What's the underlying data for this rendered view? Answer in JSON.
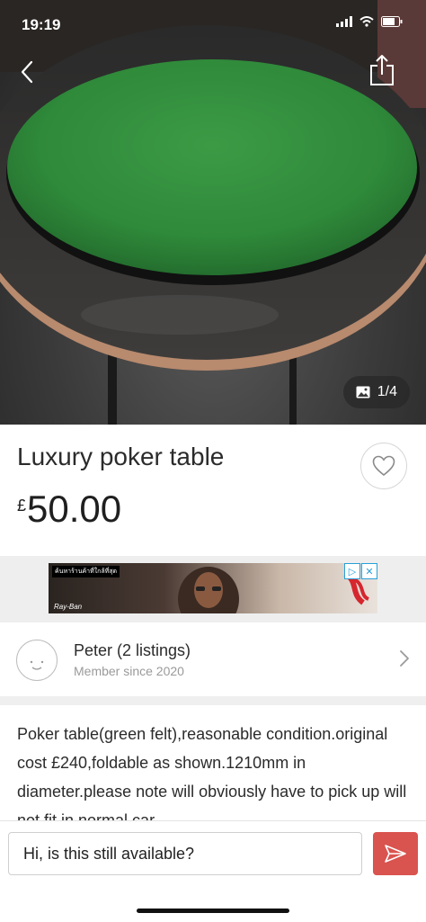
{
  "status_bar": {
    "time": "19:19"
  },
  "listing": {
    "title": "Luxury poker table",
    "price_currency": "£",
    "price_amount": "50.00",
    "photo_counter": "1/4"
  },
  "ad": {
    "tag_text": "ค้นหาร้านค้าที่ใกล้ที่สุด",
    "brand_text": "Ray-Ban"
  },
  "seller": {
    "name": "Peter (2 listings)",
    "member_since": "Member since 2020"
  },
  "description": {
    "text": "Poker table(green felt),reasonable condition.original cost £240,foldable as shown.1210mm in diameter.please note will obviously have to pick up will not fit in normal car"
  },
  "message": {
    "value": "Hi, is this still available?"
  },
  "colors": {
    "accent": "#d9534f",
    "felt_green": "#2f8a3a"
  },
  "icons": {
    "back": "chevron-left-icon",
    "share": "share-icon",
    "photo": "image-icon",
    "favorite": "heart-outline-icon",
    "seller_chevron": "chevron-right-icon",
    "send": "send-icon"
  }
}
